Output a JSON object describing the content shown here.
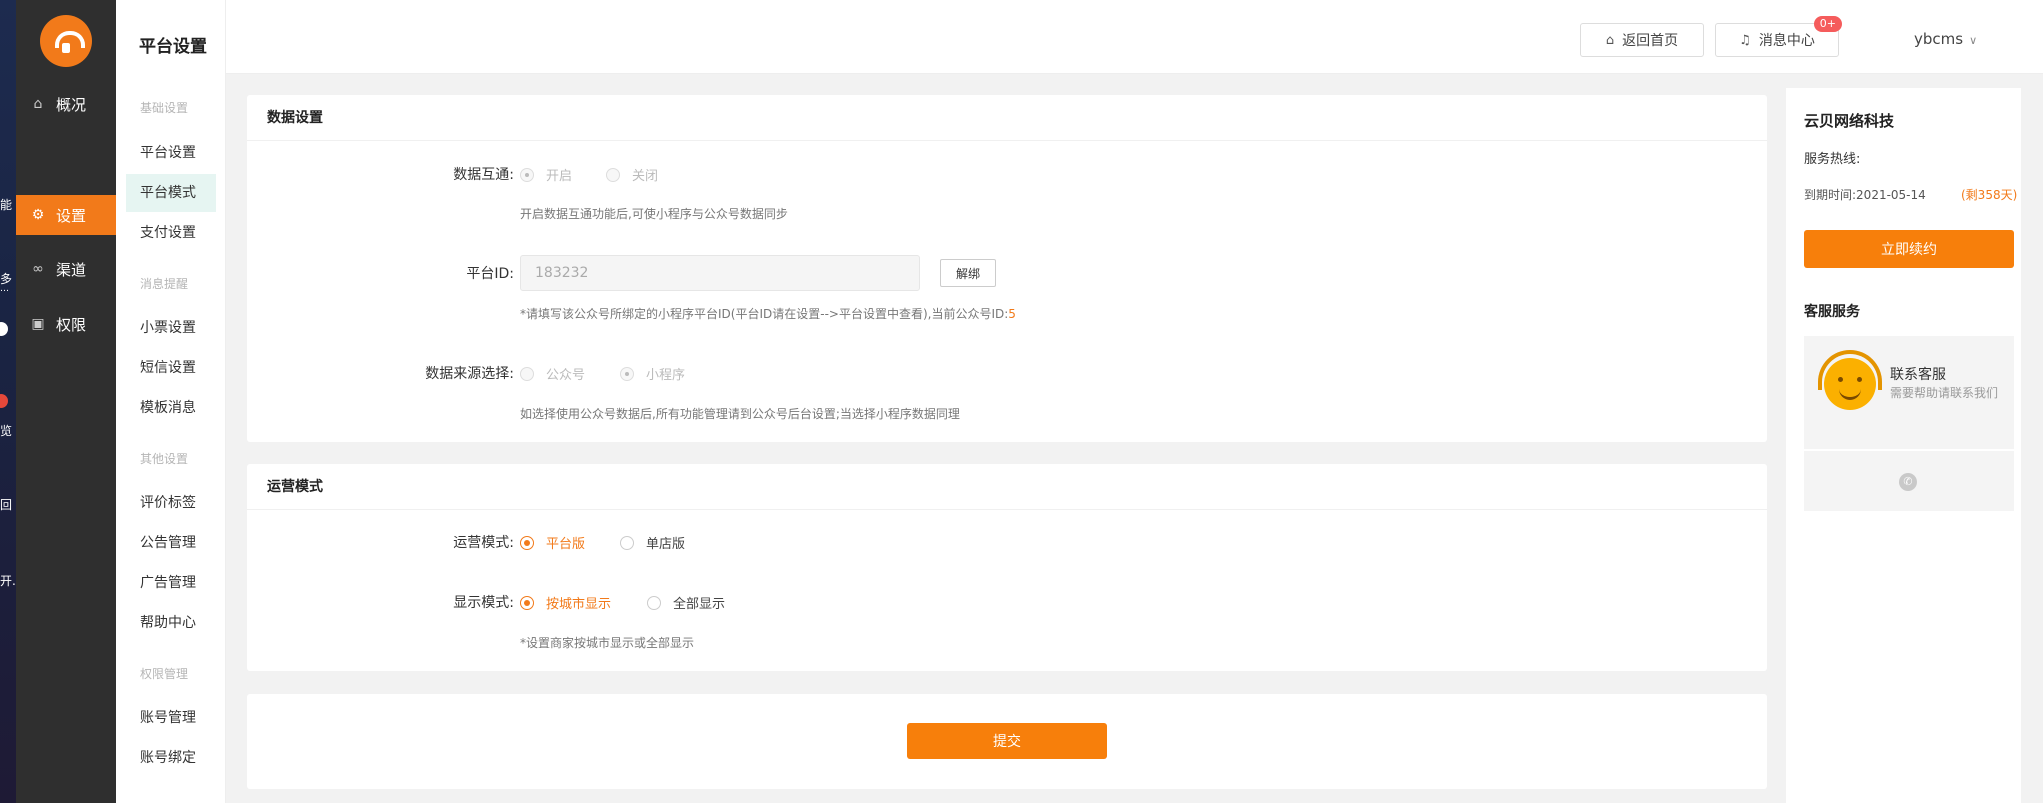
{
  "desktop": {
    "labels": [
      "能",
      "多",
      "…",
      "览",
      "回",
      "开."
    ]
  },
  "nav": {
    "items": [
      {
        "label": "概况",
        "icon": "home-icon"
      },
      {
        "label": "设置",
        "icon": "gear-icon"
      },
      {
        "label": "渠道",
        "icon": "link-icon"
      },
      {
        "label": "权限",
        "icon": "lock-icon"
      }
    ]
  },
  "subnav": {
    "title": "平台设置",
    "groups": {
      "basic": "基础设置",
      "notify": "消息提醒",
      "other": "其他设置",
      "perm": "权限管理"
    },
    "items": {
      "platform_settings": "平台设置",
      "platform_mode": "平台模式",
      "payment_settings": "支付设置",
      "ticket_settings": "小票设置",
      "sms_settings": "短信设置",
      "template_message": "模板消息",
      "review_tags": "评价标签",
      "notice_manage": "公告管理",
      "ad_manage": "广告管理",
      "help_center": "帮助中心",
      "account_manage": "账号管理",
      "account_bind": "账号绑定"
    }
  },
  "header": {
    "home_label": "返回首页",
    "messages_label": "消息中心",
    "messages_badge": "0+",
    "username": "ybcms"
  },
  "data_settings": {
    "title": "数据设置",
    "interop_label": "数据互通:",
    "interop_on": "开启",
    "interop_off": "关闭",
    "interop_hint": "开启数据互通功能后,可使小程序与公众号数据同步",
    "platform_id_label": "平台ID:",
    "platform_id_value": "183232",
    "unbind_label": "解绑",
    "platform_id_hint": "*请填写该公众号所绑定的小程序平台ID(平台ID请在设置-->平台设置中查看),当前公众号ID:",
    "current_account_id": "5",
    "source_label": "数据来源选择:",
    "source_official": "公众号",
    "source_miniprogram": "小程序",
    "source_hint": "如选择使用公众号数据后,所有功能管理请到公众号后台设置;当选择小程序数据同理"
  },
  "operation": {
    "title": "运营模式",
    "mode_label": "运营模式:",
    "mode_platform": "平台版",
    "mode_single": "单店版",
    "display_label": "显示模式:",
    "display_city": "按城市显示",
    "display_all": "全部显示",
    "display_hint": "*设置商家按城市显示或全部显示"
  },
  "submit_label": "提交",
  "right_panel": {
    "company": "云贝网络科技",
    "hotline_label": "服务热线:",
    "expire_text": "到期时间:2021-05-14",
    "days_left": "(剩358天)",
    "renew_label": "立即续约",
    "service_title": "客服服务",
    "contact_title": "联系客服",
    "contact_sub": "需要帮助请联系我们"
  }
}
